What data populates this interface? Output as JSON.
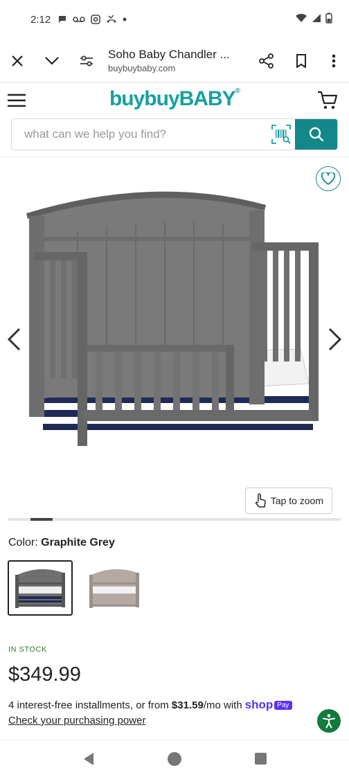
{
  "status": {
    "time": "2:12",
    "icons": [
      "chat-icon",
      "voicemail-icon",
      "instagram-icon",
      "missed-call-icon",
      "dot-icon"
    ],
    "right_icons": [
      "wifi-icon",
      "signal-icon",
      "battery-icon"
    ]
  },
  "tab": {
    "title": "Soho Baby Chandler ...",
    "domain": "buybuybaby.com"
  },
  "site": {
    "logo": "buybuyBABY",
    "logo_mark": "®"
  },
  "search": {
    "placeholder": "what can we help you find?"
  },
  "gallery": {
    "zoom_label": "Tap to zoom",
    "position": 2,
    "total": 15
  },
  "product": {
    "color_label": "Color:",
    "color_value": "Graphite Grey",
    "stock": "IN STOCK",
    "price": "$349.99",
    "install_prefix": "4 interest-free installments, or from ",
    "install_amount": "$31.59",
    "install_suffix": "/mo with",
    "shop_brand": "shop",
    "shop_pay": "Pay",
    "check_link": "Check your purchasing power"
  },
  "colors": {
    "brand": "#17a0a3",
    "brand_dark": "#14878a",
    "shop_purple": "#5a31f4",
    "stock_green": "#2e7d32",
    "access_green": "#137a3d"
  }
}
